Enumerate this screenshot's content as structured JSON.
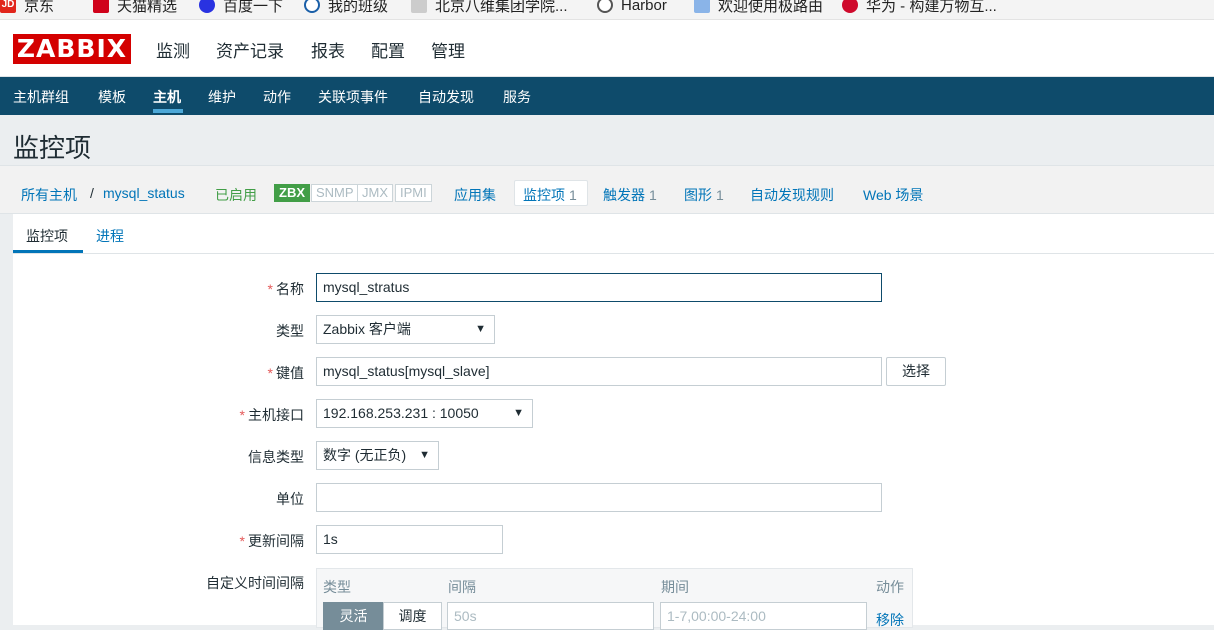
{
  "bookmarks": [
    {
      "label": "京东",
      "icon": "jd-icon"
    },
    {
      "label": "天猫精选",
      "icon": "tmall-icon"
    },
    {
      "label": "百度一下",
      "icon": "baidu-icon"
    },
    {
      "label": "我的班级",
      "icon": "globe-icon"
    },
    {
      "label": "北京八维集团学院...",
      "icon": "school-icon"
    },
    {
      "label": "Harbor",
      "icon": "harbor-icon"
    },
    {
      "label": "欢迎使用极路由",
      "icon": "router-icon"
    },
    {
      "label": "华为 - 构建万物互...",
      "icon": "huawei-icon"
    }
  ],
  "logo": "ZABBIX",
  "top_menu": [
    "监测",
    "资产记录",
    "报表",
    "配置",
    "管理"
  ],
  "top_menu_active": "配置",
  "sub_nav": [
    "主机群组",
    "模板",
    "主机",
    "维护",
    "动作",
    "关联项事件",
    "自动发现",
    "服务"
  ],
  "sub_nav_active": "主机",
  "page_title": "监控项",
  "breadcrumb": {
    "all_hosts": "所有主机",
    "separator": "/",
    "host": "mysql_status",
    "status": "已启用",
    "availability": [
      "ZBX",
      "SNMP",
      "JMX",
      "IPMI"
    ],
    "links": [
      {
        "label": "应用集",
        "count": ""
      },
      {
        "label": "监控项",
        "count": "1"
      },
      {
        "label": "触发器",
        "count": "1"
      },
      {
        "label": "图形",
        "count": "1"
      },
      {
        "label": "自动发现规则",
        "count": ""
      },
      {
        "label": "Web 场景",
        "count": ""
      }
    ]
  },
  "tabs": [
    "监控项",
    "进程"
  ],
  "form": {
    "name_label": "名称",
    "name_value": "mysql_stratus",
    "type_label": "类型",
    "type_value": "Zabbix 客户端",
    "key_label": "键值",
    "key_value": "mysql_status[mysql_slave]",
    "key_button": "选择",
    "interface_label": "主机接口",
    "interface_value": "192.168.253.231 : 10050",
    "info_type_label": "信息类型",
    "info_type_value": "数字 (无正负)",
    "units_label": "单位",
    "units_value": "",
    "interval_label": "更新间隔",
    "interval_value": "1s",
    "custom_label": "自定义时间间隔",
    "custom": {
      "col_type": "类型",
      "col_interval": "间隔",
      "col_period": "期间",
      "col_action": "动作",
      "flexible": "灵活",
      "scheduling": "调度",
      "interval_placeholder": "50s",
      "period_placeholder": "1-7,00:00-24:00",
      "remove": "移除"
    }
  },
  "colors": {
    "brand": "#d40000",
    "subnav": "#0e4b6b",
    "link": "#0275b8",
    "required": "#e45959",
    "enabled": "#429e47"
  }
}
